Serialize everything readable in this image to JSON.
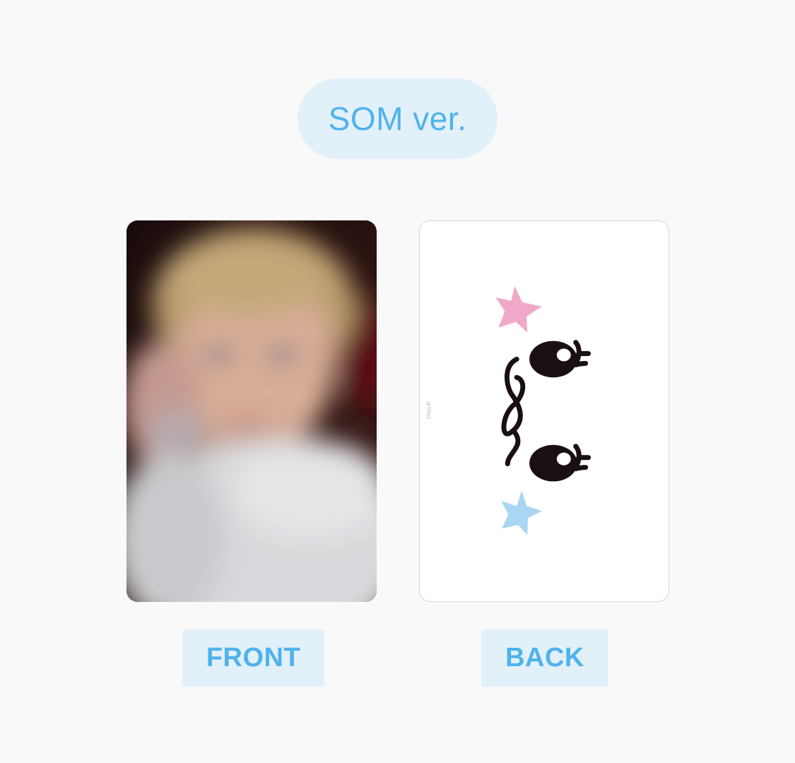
{
  "version_badge": "SOM ver.",
  "front": {
    "label": "FRONT",
    "image_description": "blurred photocard portrait"
  },
  "back": {
    "label": "BACK",
    "credit": "@TRUZ"
  },
  "colors": {
    "accent_text": "#4fb3ec",
    "pill_bg": "#e2f0f9",
    "page_bg": "#f9f9f9",
    "pink_star": "#f0a9c9",
    "blue_star": "#a9d6f2",
    "face_ink": "#1a1012"
  },
  "icons": [
    "pink-star-icon",
    "blue-star-icon",
    "eye-icon",
    "nose-icon"
  ]
}
